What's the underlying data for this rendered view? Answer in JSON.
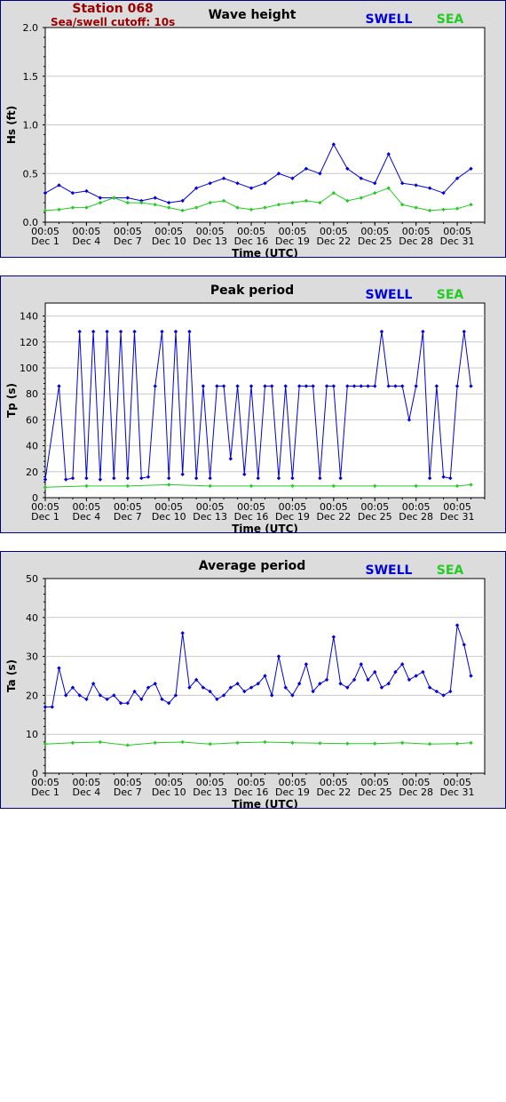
{
  "header": {
    "station": "Station 068",
    "cutoff": "Sea/swell cutoff: 10s"
  },
  "legend": {
    "swell": "SWELL",
    "sea": "SEA"
  },
  "colors": {
    "swell": "#0000dd",
    "sea": "#22cc22",
    "title_red": "#990000",
    "panel_bg": "#dcdcdc",
    "plot_bg": "#ffffff",
    "border": "#00007f"
  },
  "x_axis": {
    "label": "Time (UTC)",
    "ticks": [
      {
        "time": "00:05",
        "date": "Dec 1"
      },
      {
        "time": "00:05",
        "date": "Dec 4"
      },
      {
        "time": "00:05",
        "date": "Dec 7"
      },
      {
        "time": "00:05",
        "date": "Dec 10"
      },
      {
        "time": "00:05",
        "date": "Dec 13"
      },
      {
        "time": "00:05",
        "date": "Dec 16"
      },
      {
        "time": "00:05",
        "date": "Dec 19"
      },
      {
        "time": "00:05",
        "date": "Dec 22"
      },
      {
        "time": "00:05",
        "date": "Dec 25"
      },
      {
        "time": "00:05",
        "date": "Dec 28"
      },
      {
        "time": "00:05",
        "date": "Dec 31"
      }
    ]
  },
  "chart_data": [
    {
      "type": "line",
      "title": "Wave height",
      "ylabel": "Hs (ft)",
      "ylim": [
        0,
        2.0
      ],
      "yticks": [
        "0.0",
        "0.5",
        "1.0",
        "1.5",
        "2.0"
      ],
      "grid": true,
      "legend": "top-right",
      "series": [
        {
          "name": "SWELL",
          "points": [
            [
              1.0,
              0.3
            ],
            [
              2.0,
              0.38
            ],
            [
              3.0,
              0.3
            ],
            [
              4.0,
              0.32
            ],
            [
              5.0,
              0.25
            ],
            [
              6.0,
              0.25
            ],
            [
              7.0,
              0.25
            ],
            [
              8.0,
              0.22
            ],
            [
              9.0,
              0.25
            ],
            [
              10.0,
              0.2
            ],
            [
              11.0,
              0.22
            ],
            [
              12.0,
              0.35
            ],
            [
              13.0,
              0.4
            ],
            [
              14.0,
              0.45
            ],
            [
              15.0,
              0.4
            ],
            [
              16.0,
              0.35
            ],
            [
              17.0,
              0.4
            ],
            [
              18.0,
              0.5
            ],
            [
              19.0,
              0.45
            ],
            [
              20.0,
              0.55
            ],
            [
              21.0,
              0.5
            ],
            [
              22.0,
              0.8
            ],
            [
              23.0,
              0.55
            ],
            [
              24.0,
              0.45
            ],
            [
              25.0,
              0.4
            ],
            [
              26.0,
              0.7
            ],
            [
              27.0,
              0.4
            ],
            [
              28.0,
              0.38
            ],
            [
              29.0,
              0.35
            ],
            [
              30.0,
              0.3
            ],
            [
              31.0,
              0.45
            ],
            [
              32.0,
              0.55
            ]
          ]
        },
        {
          "name": "SEA",
          "points": [
            [
              1.0,
              0.12
            ],
            [
              2.0,
              0.13
            ],
            [
              3.0,
              0.15
            ],
            [
              4.0,
              0.15
            ],
            [
              5.0,
              0.2
            ],
            [
              6.0,
              0.25
            ],
            [
              7.0,
              0.2
            ],
            [
              8.0,
              0.2
            ],
            [
              9.0,
              0.18
            ],
            [
              10.0,
              0.15
            ],
            [
              11.0,
              0.12
            ],
            [
              12.0,
              0.15
            ],
            [
              13.0,
              0.2
            ],
            [
              14.0,
              0.22
            ],
            [
              15.0,
              0.15
            ],
            [
              16.0,
              0.13
            ],
            [
              17.0,
              0.15
            ],
            [
              18.0,
              0.18
            ],
            [
              19.0,
              0.2
            ],
            [
              20.0,
              0.22
            ],
            [
              21.0,
              0.2
            ],
            [
              22.0,
              0.3
            ],
            [
              23.0,
              0.22
            ],
            [
              24.0,
              0.25
            ],
            [
              25.0,
              0.3
            ],
            [
              26.0,
              0.35
            ],
            [
              27.0,
              0.18
            ],
            [
              28.0,
              0.15
            ],
            [
              29.0,
              0.12
            ],
            [
              30.0,
              0.13
            ],
            [
              31.0,
              0.14
            ],
            [
              32.0,
              0.18
            ]
          ]
        }
      ]
    },
    {
      "type": "line",
      "title": "Peak period",
      "ylabel": "Tp (s)",
      "ylim": [
        0,
        150
      ],
      "yticks": [
        "0",
        "20",
        "40",
        "60",
        "80",
        "100",
        "120",
        "140"
      ],
      "grid": true,
      "legend": "top-right",
      "series": [
        {
          "name": "SWELL",
          "points": [
            [
              1.0,
              14
            ],
            [
              2.0,
              86
            ],
            [
              2.5,
              14
            ],
            [
              3.0,
              15
            ],
            [
              3.5,
              128
            ],
            [
              4.0,
              15
            ],
            [
              4.5,
              128
            ],
            [
              5.0,
              14
            ],
            [
              5.5,
              128
            ],
            [
              6.0,
              15
            ],
            [
              6.5,
              128
            ],
            [
              7.0,
              15
            ],
            [
              7.5,
              128
            ],
            [
              8.0,
              15
            ],
            [
              8.5,
              16
            ],
            [
              9.0,
              86
            ],
            [
              9.5,
              128
            ],
            [
              10.0,
              15
            ],
            [
              10.5,
              128
            ],
            [
              11.0,
              18
            ],
            [
              11.5,
              128
            ],
            [
              12.0,
              15
            ],
            [
              12.5,
              86
            ],
            [
              13.0,
              15
            ],
            [
              13.5,
              86
            ],
            [
              14.0,
              86
            ],
            [
              14.5,
              30
            ],
            [
              15.0,
              86
            ],
            [
              15.5,
              18
            ],
            [
              16.0,
              86
            ],
            [
              16.5,
              15
            ],
            [
              17.0,
              86
            ],
            [
              17.5,
              86
            ],
            [
              18.0,
              15
            ],
            [
              18.5,
              86
            ],
            [
              19.0,
              15
            ],
            [
              19.5,
              86
            ],
            [
              20.0,
              86
            ],
            [
              20.5,
              86
            ],
            [
              21.0,
              15
            ],
            [
              21.5,
              86
            ],
            [
              22.0,
              86
            ],
            [
              22.5,
              15
            ],
            [
              23.0,
              86
            ],
            [
              23.5,
              86
            ],
            [
              24.0,
              86
            ],
            [
              24.5,
              86
            ],
            [
              25.0,
              86
            ],
            [
              25.5,
              128
            ],
            [
              26.0,
              86
            ],
            [
              26.5,
              86
            ],
            [
              27.0,
              86
            ],
            [
              27.5,
              60
            ],
            [
              28.0,
              86
            ],
            [
              28.5,
              128
            ],
            [
              29.0,
              15
            ],
            [
              29.5,
              86
            ],
            [
              30.0,
              16
            ],
            [
              30.5,
              15
            ],
            [
              31.0,
              86
            ],
            [
              31.5,
              128
            ],
            [
              32.0,
              86
            ]
          ]
        },
        {
          "name": "SEA",
          "points": [
            [
              1.0,
              8
            ],
            [
              4.0,
              9
            ],
            [
              7.0,
              9
            ],
            [
              10.0,
              10
            ],
            [
              13.0,
              9
            ],
            [
              16.0,
              9
            ],
            [
              19.0,
              9
            ],
            [
              22.0,
              9
            ],
            [
              25.0,
              9
            ],
            [
              28.0,
              9
            ],
            [
              31.0,
              9
            ],
            [
              32.0,
              10
            ]
          ]
        }
      ]
    },
    {
      "type": "line",
      "title": "Average period",
      "ylabel": "Ta (s)",
      "ylim": [
        0,
        50
      ],
      "yticks": [
        "0",
        "10",
        "20",
        "30",
        "40",
        "50"
      ],
      "grid": true,
      "legend": "top-right",
      "series": [
        {
          "name": "SWELL",
          "points": [
            [
              1.0,
              17
            ],
            [
              1.5,
              17
            ],
            [
              2.0,
              27
            ],
            [
              2.5,
              20
            ],
            [
              3.0,
              22
            ],
            [
              3.5,
              20
            ],
            [
              4.0,
              19
            ],
            [
              4.5,
              23
            ],
            [
              5.0,
              20
            ],
            [
              5.5,
              19
            ],
            [
              6.0,
              20
            ],
            [
              6.5,
              18
            ],
            [
              7.0,
              18
            ],
            [
              7.5,
              21
            ],
            [
              8.0,
              19
            ],
            [
              8.5,
              22
            ],
            [
              9.0,
              23
            ],
            [
              9.5,
              19
            ],
            [
              10.0,
              18
            ],
            [
              10.5,
              20
            ],
            [
              11.0,
              36
            ],
            [
              11.5,
              22
            ],
            [
              12.0,
              24
            ],
            [
              12.5,
              22
            ],
            [
              13.0,
              21
            ],
            [
              13.5,
              19
            ],
            [
              14.0,
              20
            ],
            [
              14.5,
              22
            ],
            [
              15.0,
              23
            ],
            [
              15.5,
              21
            ],
            [
              16.0,
              22
            ],
            [
              16.5,
              23
            ],
            [
              17.0,
              25
            ],
            [
              17.5,
              20
            ],
            [
              18.0,
              30
            ],
            [
              18.5,
              22
            ],
            [
              19.0,
              20
            ],
            [
              19.5,
              23
            ],
            [
              20.0,
              28
            ],
            [
              20.5,
              21
            ],
            [
              21.0,
              23
            ],
            [
              21.5,
              24
            ],
            [
              22.0,
              35
            ],
            [
              22.5,
              23
            ],
            [
              23.0,
              22
            ],
            [
              23.5,
              24
            ],
            [
              24.0,
              28
            ],
            [
              24.5,
              24
            ],
            [
              25.0,
              26
            ],
            [
              25.5,
              22
            ],
            [
              26.0,
              23
            ],
            [
              26.5,
              26
            ],
            [
              27.0,
              28
            ],
            [
              27.5,
              24
            ],
            [
              28.0,
              25
            ],
            [
              28.5,
              26
            ],
            [
              29.0,
              22
            ],
            [
              29.5,
              21
            ],
            [
              30.0,
              20
            ],
            [
              30.5,
              21
            ],
            [
              31.0,
              38
            ],
            [
              31.5,
              33
            ],
            [
              32.0,
              25
            ]
          ]
        },
        {
          "name": "SEA",
          "points": [
            [
              1.0,
              7.5
            ],
            [
              3.0,
              7.8
            ],
            [
              5.0,
              8
            ],
            [
              7.0,
              7.2
            ],
            [
              9.0,
              7.8
            ],
            [
              11.0,
              8
            ],
            [
              13.0,
              7.5
            ],
            [
              15.0,
              7.8
            ],
            [
              17.0,
              8
            ],
            [
              19.0,
              7.8
            ],
            [
              21.0,
              7.7
            ],
            [
              23.0,
              7.6
            ],
            [
              25.0,
              7.6
            ],
            [
              27.0,
              7.8
            ],
            [
              29.0,
              7.5
            ],
            [
              31.0,
              7.6
            ],
            [
              32.0,
              7.8
            ]
          ]
        }
      ]
    }
  ]
}
